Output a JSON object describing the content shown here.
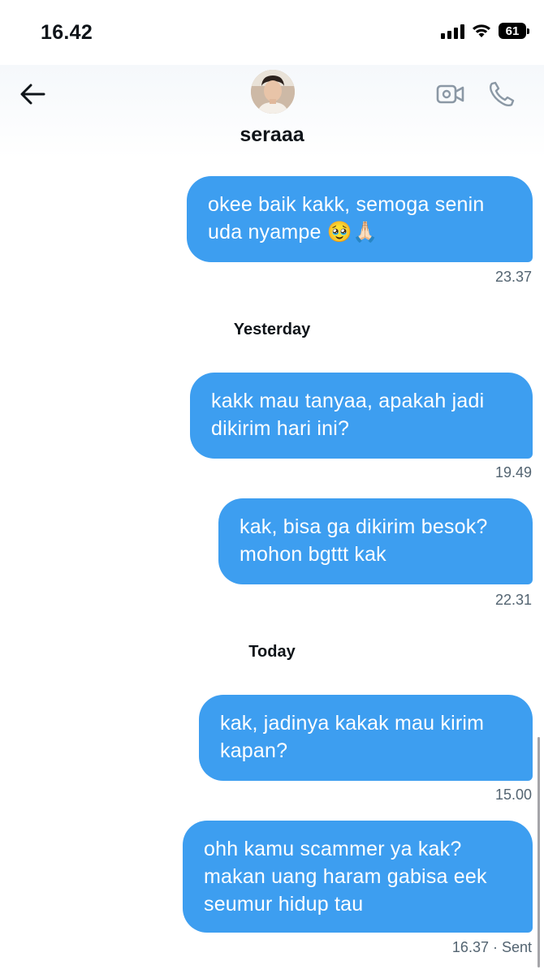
{
  "status_bar": {
    "time": "16.42",
    "battery": "61"
  },
  "header": {
    "back_icon": "arrow-left-icon",
    "contact_name": "seraaa",
    "video_icon": "video-camera-icon",
    "call_icon": "phone-icon"
  },
  "messages": [
    {
      "text": "okee baik kakk, semoga senin uda nyampe 🥹🙏🏻",
      "time": "23.37"
    },
    {
      "text": "kakk mau tanyaa, apakah jadi dikirim hari ini?",
      "time": "19.49"
    },
    {
      "text": "kak, bisa ga dikirim besok? mohon bgttt kak",
      "time": "22.31"
    },
    {
      "text": "kak, jadinya kakak mau kirim kapan?",
      "time": "15.00"
    },
    {
      "text": "ohh kamu scammer ya kak? makan uang haram gabisa eek seumur hidup tau",
      "time": "16.37 · Sent"
    }
  ],
  "day_separators": {
    "yesterday": "Yesterday",
    "today": "Today"
  },
  "colors": {
    "bubble": "#3d9ef0",
    "timestamp": "#536471",
    "icon_gray": "#8b98a5"
  }
}
